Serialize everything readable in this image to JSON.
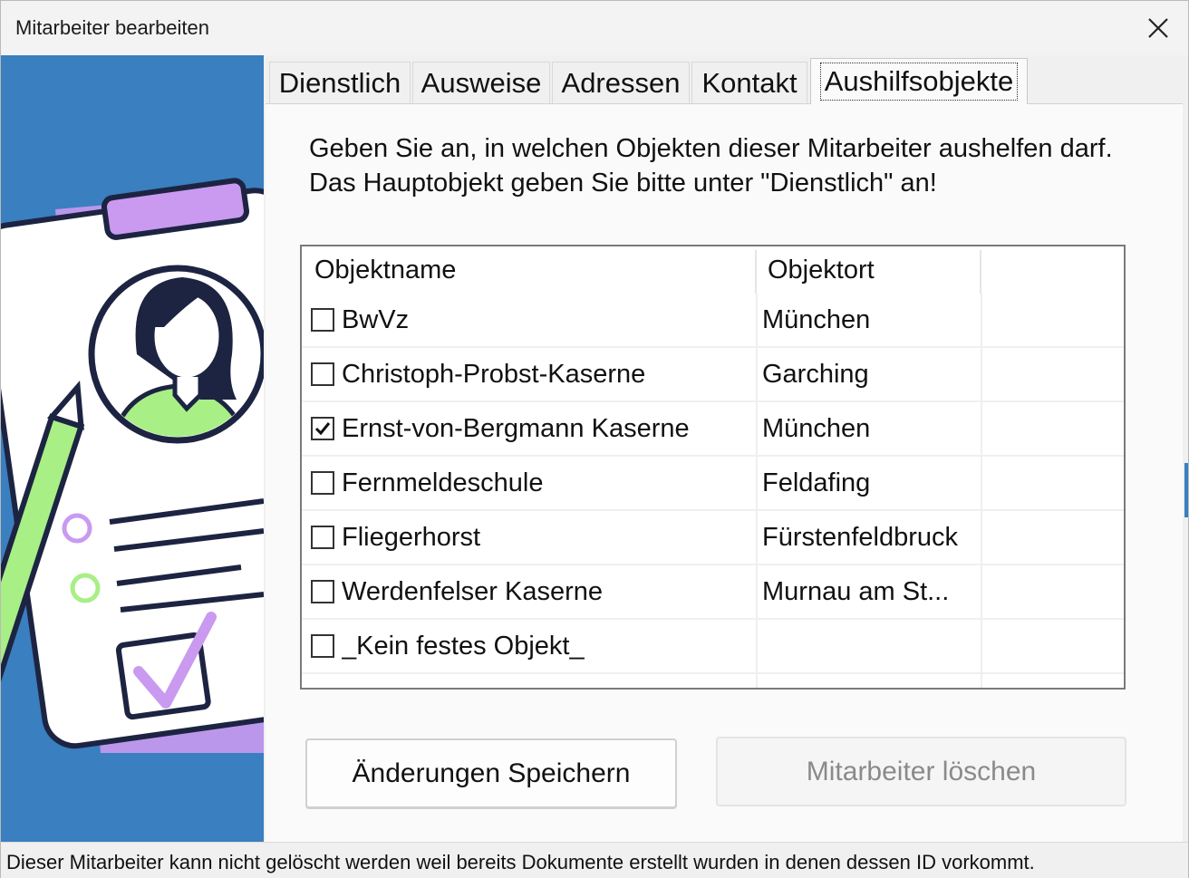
{
  "window": {
    "title": "Mitarbeiter bearbeiten"
  },
  "tabs": [
    {
      "label": "Dienstlich"
    },
    {
      "label": "Ausweise"
    },
    {
      "label": "Adressen"
    },
    {
      "label": "Kontakt"
    },
    {
      "label": "Aushilfsobjekte",
      "active": true
    }
  ],
  "panel": {
    "instruction": "Geben Sie an, in welchen Objekten dieser Mitarbeiter aushelfen darf. Das Hauptobjekt geben Sie bitte unter \"Dienstlich\" an!"
  },
  "list": {
    "columns": [
      "Objektname",
      "Objektort"
    ],
    "rows": [
      {
        "name": "BwVz",
        "ort": "München",
        "checked": false
      },
      {
        "name": "Christoph-Probst-Kaserne",
        "ort": "Garching",
        "checked": false
      },
      {
        "name": "Ernst-von-Bergmann Kaserne",
        "ort": "München",
        "checked": true
      },
      {
        "name": "Fernmeldeschule",
        "ort": "Feldafing",
        "checked": false
      },
      {
        "name": "Fliegerhorst",
        "ort": "Fürstenfeldbruck",
        "checked": false
      },
      {
        "name": "Werdenfelser Kaserne",
        "ort": "Murnau am St...",
        "checked": false
      },
      {
        "name": "_Kein festes Objekt_",
        "ort": "",
        "checked": false
      }
    ]
  },
  "buttons": {
    "save": "Änderungen Speichern",
    "delete": "Mitarbeiter löschen"
  },
  "status": "Dieser Mitarbeiter kann nicht gelöscht werden weil bereits Dokumente erstellt wurden in denen dessen ID vorkommt.",
  "colors": {
    "sidebar": "#3a7fbf",
    "accent_purple": "#c99af0",
    "accent_green": "#a8ef86",
    "ink": "#1d2442"
  }
}
